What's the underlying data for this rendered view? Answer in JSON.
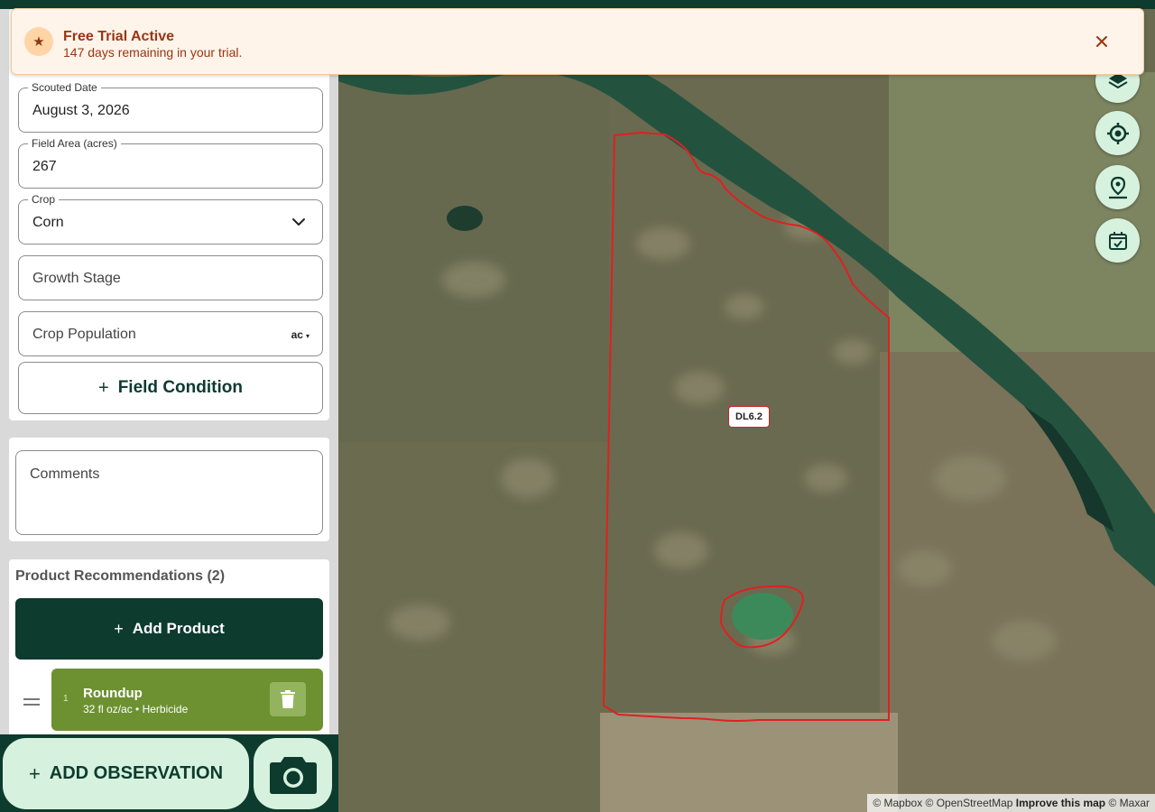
{
  "banner": {
    "title": "Free Trial Active",
    "subtitle": "147 days remaining in your trial.",
    "icon": "star-icon",
    "accent": "#9a3412"
  },
  "form": {
    "scouted_date": {
      "label": "Scouted Date",
      "value": "August 3, 2026"
    },
    "field_area": {
      "label": "Field Area (acres)",
      "value": "267"
    },
    "crop": {
      "label": "Crop",
      "value": "Corn"
    },
    "growth_stage": {
      "placeholder": "Growth Stage"
    },
    "crop_population": {
      "placeholder": "Crop Population",
      "unit": "ac"
    },
    "field_condition_label": "Field Condition",
    "comments_placeholder": "Comments"
  },
  "products": {
    "title": "Product Recommendations (2)",
    "add_label": "Add Product",
    "items": [
      {
        "index": "1",
        "name": "Roundup",
        "detail": "32 fl oz/ac • Herbicide",
        "color": "#6d9130"
      }
    ]
  },
  "actions": {
    "add_observation_label": "ADD OBSERVATION"
  },
  "map": {
    "field_label": "DL6.2",
    "boundary_color": "#e02020",
    "controls": [
      "layers-icon",
      "locate-icon",
      "drop-pin-icon",
      "calendar-check-icon"
    ],
    "attribution": {
      "mapbox": "© Mapbox",
      "osm": "© OpenStreetMap",
      "improve": "Improve this map",
      "maxar": "© Maxar"
    }
  },
  "colors": {
    "brand_dark": "#0d3b2e",
    "brand_light": "#d6f2df"
  }
}
